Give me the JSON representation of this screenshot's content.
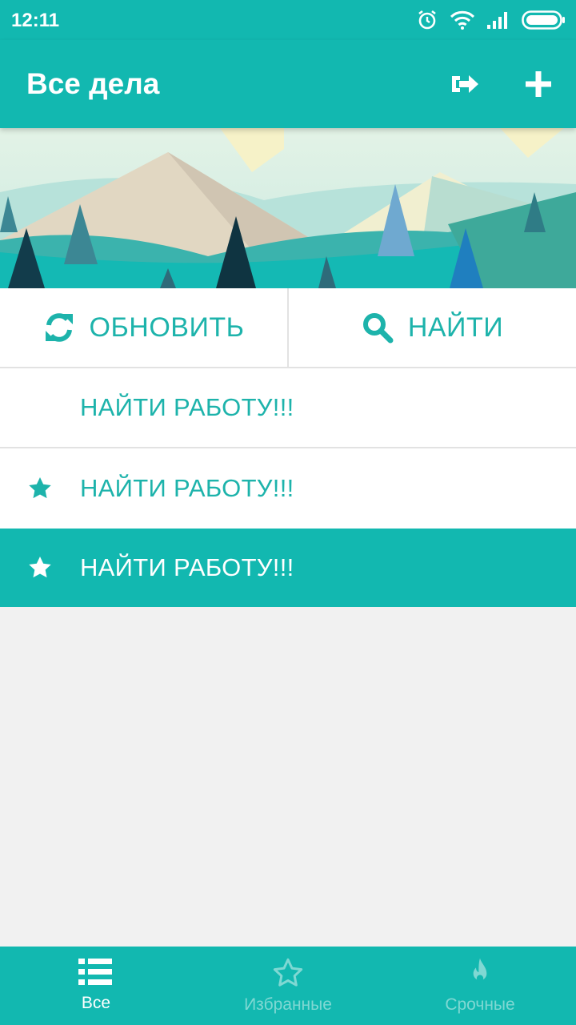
{
  "status_bar": {
    "time": "12:11"
  },
  "app_bar": {
    "title": "Все дела"
  },
  "actions": {
    "refresh_label": "ОБНОВИТЬ",
    "search_label": "НАЙТИ"
  },
  "tasks": [
    {
      "title": "НАЙТИ РАБОТУ!!!",
      "starred": false,
      "selected": false
    },
    {
      "title": "НАЙТИ РАБОТУ!!!",
      "starred": true,
      "selected": false
    },
    {
      "title": "НАЙТИ РАБОТУ!!!",
      "starred": true,
      "selected": true
    }
  ],
  "bottom_nav": {
    "items": [
      {
        "label": "Все",
        "icon": "list-icon",
        "active": true
      },
      {
        "label": "Избранные",
        "icon": "star-outline-icon",
        "active": false
      },
      {
        "label": "Срочные",
        "icon": "flame-icon",
        "active": false
      }
    ]
  },
  "colors": {
    "primary": "#12b8b0",
    "accent_text": "#1db3ab",
    "background": "#f1f1f1"
  }
}
